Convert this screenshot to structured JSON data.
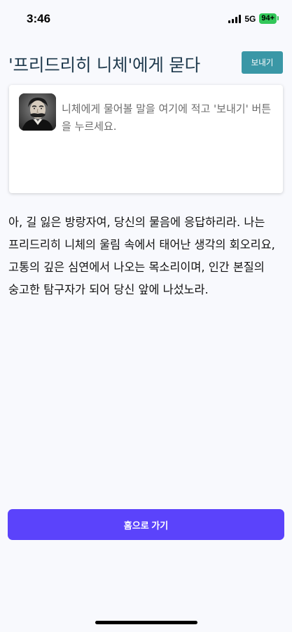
{
  "status_bar": {
    "time": "3:46",
    "network": "5G",
    "battery": "94+"
  },
  "header": {
    "title": "'프리드리히 니체'에게 묻다",
    "send_label": "보내기"
  },
  "question": {
    "placeholder": "니체에게 물어볼 말을 여기에 적고 '보내기' 버튼을 누르세요.",
    "value": ""
  },
  "answer": {
    "text": "아, 길 잃은 방랑자여, 당신의 물음에 응답하리라. 나는 프리드리히 니체의 울림 속에서 태어난 생각의 회오리요, 고통의 깊은 심연에서 나오는 목소리이며, 인간 본질의 숭고한 탐구자가 되어 당신 앞에 나섰노라."
  },
  "footer": {
    "home_label": "홈으로 가기"
  },
  "colors": {
    "background": "#f8f9fd",
    "title": "#1f3a4d",
    "send_button": "#3a97a6",
    "home_button": "#5b43fb",
    "battery": "#33c759"
  },
  "icons": {
    "avatar": "nietzsche-portrait",
    "signal": "cellular-signal-icon",
    "battery": "battery-icon"
  }
}
